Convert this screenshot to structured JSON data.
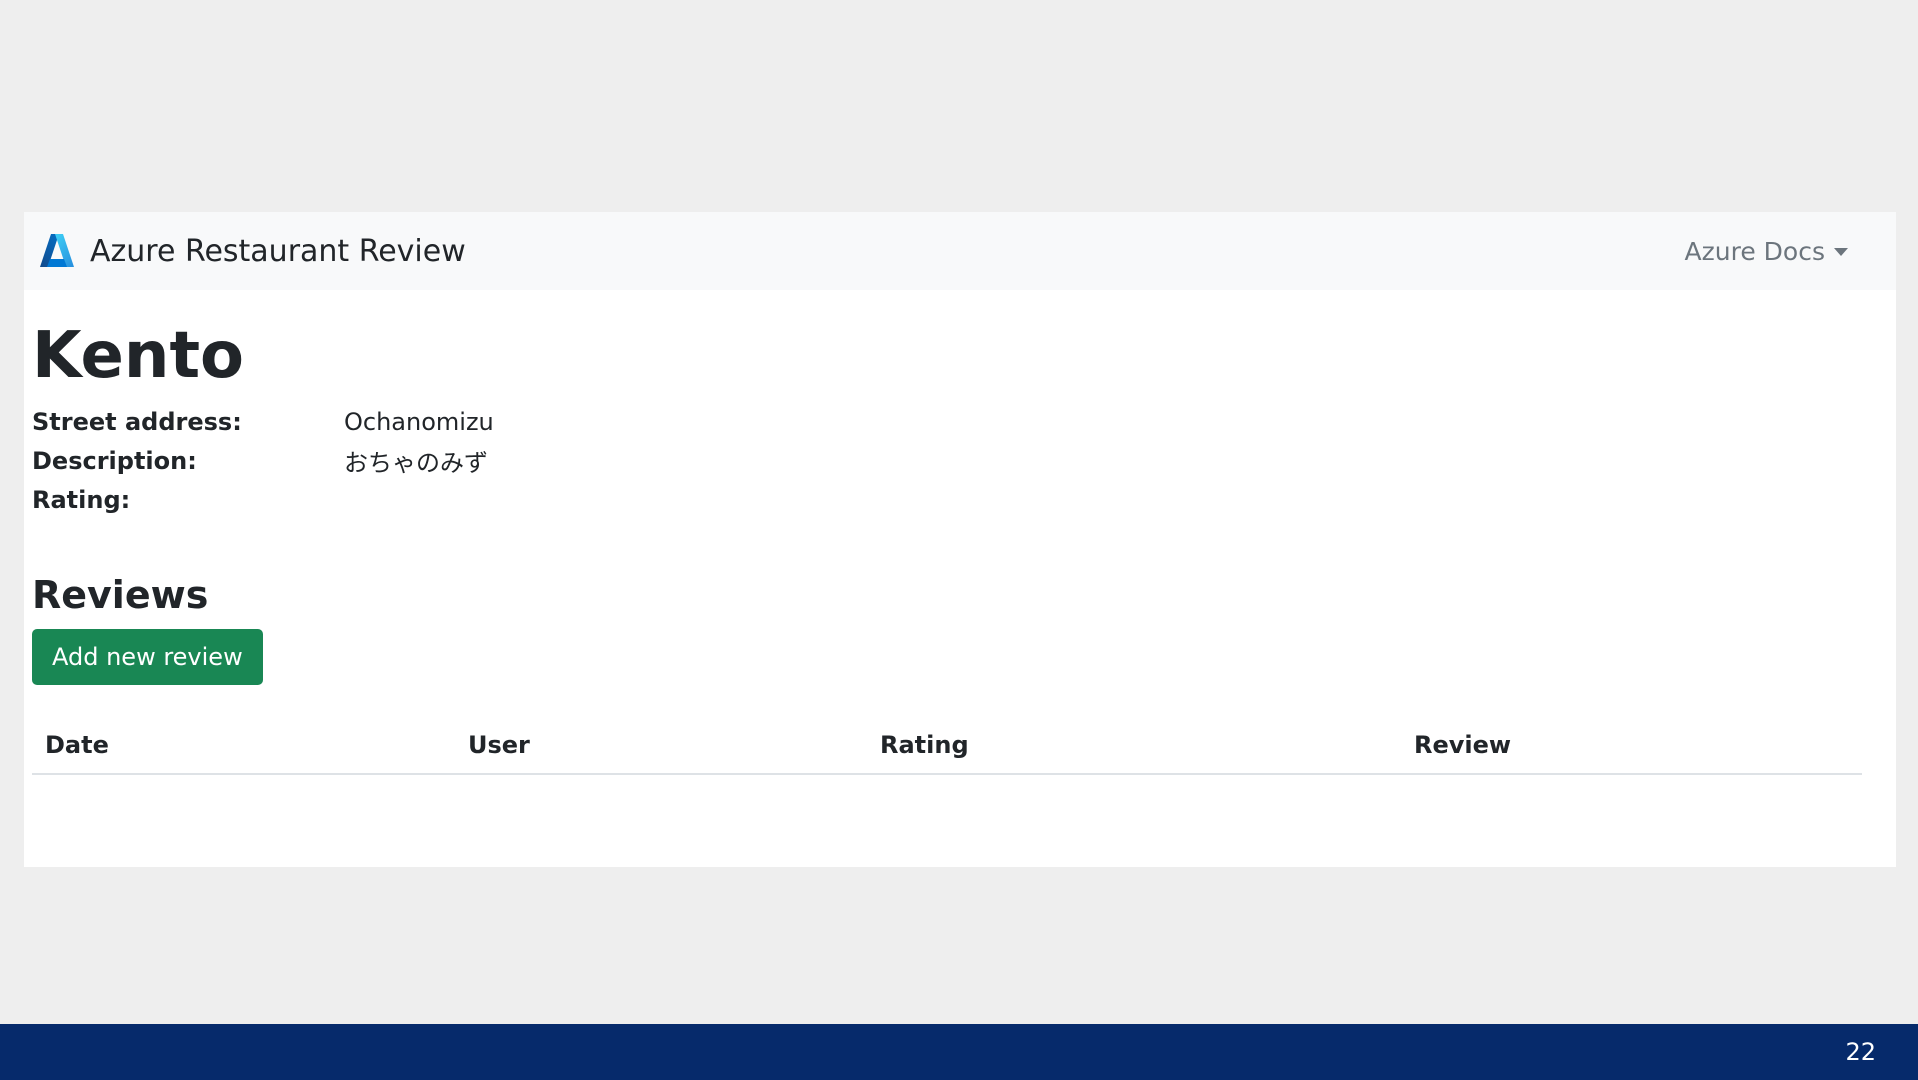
{
  "navbar": {
    "brand_title": "Azure Restaurant Review",
    "dropdown_label": "Azure Docs",
    "logo_icon": "azure-logo-icon"
  },
  "restaurant": {
    "name": "Kento",
    "details": [
      {
        "label": "Street address:",
        "value": "Ochanomizu"
      },
      {
        "label": "Description:",
        "value": "おちゃのみず"
      },
      {
        "label": "Rating:",
        "value": ""
      }
    ]
  },
  "reviews": {
    "heading": "Reviews",
    "add_button_label": "Add new review",
    "columns": [
      "Date",
      "User",
      "Rating",
      "Review"
    ],
    "rows": []
  },
  "slide": {
    "page_number": "22"
  },
  "colors": {
    "slide_background": "#eeeeee",
    "navbar_background": "#f8f9fa",
    "button_green": "#198754",
    "footer_navy": "#062a6b"
  }
}
